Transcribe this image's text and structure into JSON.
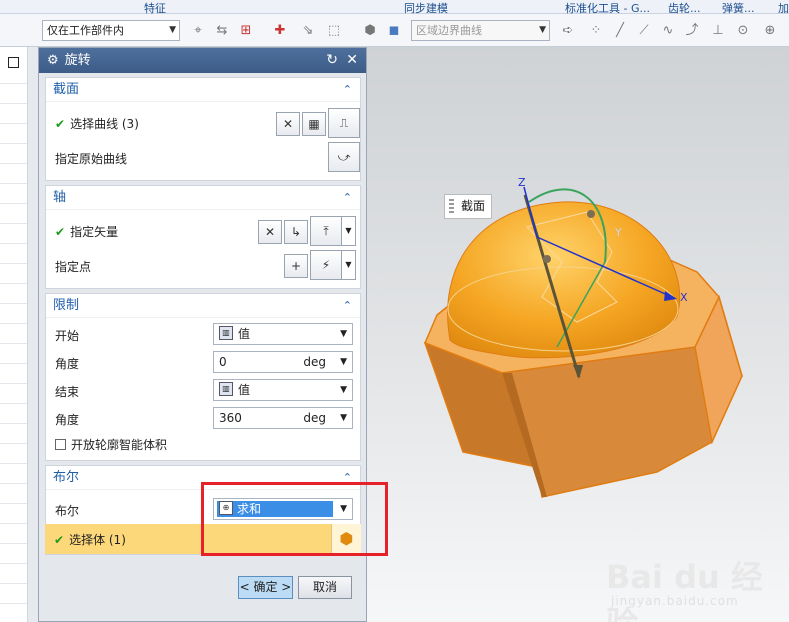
{
  "ribbon": {
    "features_label": "特征",
    "sync_label": "同步建模",
    "std_tools_label": "标准化工具 - G...",
    "gear_label": "齿轮...",
    "spring_label": "弹簧...",
    "more_label": "加"
  },
  "toolbar": {
    "scope_value": "仅在工作部件内",
    "curve_rule_value": "区域边界曲线"
  },
  "dialog": {
    "title": "旋转",
    "section": {
      "header": "截面",
      "select_curve": "选择曲线 (3)",
      "origin_curve": "指定原始曲线"
    },
    "axis": {
      "header": "轴",
      "vector": "指定矢量",
      "point": "指定点"
    },
    "limits": {
      "header": "限制",
      "start_label": "开始",
      "start_value": "值",
      "start_angle_label": "角度",
      "start_angle_value": "0",
      "unit": "deg",
      "end_label": "结束",
      "end_value": "值",
      "end_angle_label": "角度",
      "end_angle_value": "360",
      "end_unit": "deg",
      "open_profile": "开放轮廓智能体积"
    },
    "boolean": {
      "header": "布尔",
      "label": "布尔",
      "value": "求和",
      "select_body": "选择体 (1)"
    },
    "ok": "< 确定 >",
    "cancel": "取消"
  },
  "viewport": {
    "tooltip": "截面",
    "axis_z": "Z",
    "axis_x": "X",
    "axis_y": "Y"
  },
  "watermark": {
    "main": "Bai du 经验",
    "sub": "jingyan.baidu.com"
  },
  "colors": {
    "dialog_title_bg": "#4a6a96",
    "section_header": "#1f5fa8",
    "selected_row": "#fdd87a",
    "highlight_select": "#3a8ee6",
    "solid_orange": "#e08a2a",
    "dome_orange": "#f5a623",
    "annotation_red": "#e62129"
  }
}
